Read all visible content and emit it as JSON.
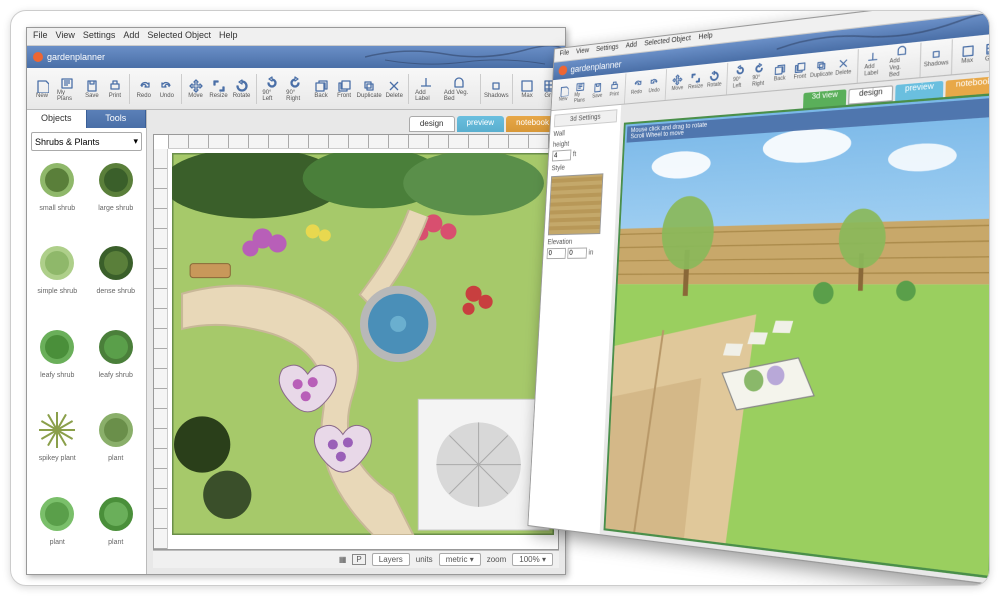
{
  "app": {
    "name": "gardenplanner"
  },
  "menu": [
    "File",
    "View",
    "Settings",
    "Add",
    "Selected Object",
    "Help"
  ],
  "toolbar": [
    {
      "icon": "new",
      "label": "New"
    },
    {
      "icon": "plans",
      "label": "My Plans"
    },
    {
      "icon": "save",
      "label": "Save"
    },
    {
      "icon": "print",
      "label": "Print"
    },
    {
      "sep": true
    },
    {
      "icon": "redo",
      "label": "Redo"
    },
    {
      "icon": "undo",
      "label": "Undo"
    },
    {
      "sep": true
    },
    {
      "icon": "move",
      "label": "Move"
    },
    {
      "icon": "resize",
      "label": "Resize"
    },
    {
      "icon": "rotate",
      "label": "Rotate"
    },
    {
      "sep": true
    },
    {
      "icon": "rot-l",
      "label": "90° Left"
    },
    {
      "icon": "rot-r",
      "label": "90° Right"
    },
    {
      "icon": "back",
      "label": "Back"
    },
    {
      "icon": "front",
      "label": "Front"
    },
    {
      "icon": "dup",
      "label": "Duplicate"
    },
    {
      "icon": "del",
      "label": "Delete"
    },
    {
      "sep": true
    },
    {
      "icon": "label",
      "label": "Add Label"
    },
    {
      "icon": "veg",
      "label": "Add Veg. Bed"
    },
    {
      "sep": true
    },
    {
      "icon": "shadow",
      "label": "Shadows"
    },
    {
      "sep": true
    },
    {
      "icon": "max",
      "label": "Max"
    },
    {
      "icon": "grid",
      "label": "Grid"
    }
  ],
  "sideTabs": {
    "objects": "Objects",
    "tools": "Tools"
  },
  "category": "Shrubs & Plants",
  "objects": [
    {
      "label": "small shrub",
      "fill": "#5a7f3a",
      "ring": "#8fb86a"
    },
    {
      "label": "large shrub",
      "fill": "#3a5f2a",
      "ring": "#5a7f3a"
    },
    {
      "label": "simple shrub",
      "fill": "#8fb86a",
      "ring": "#aecf8a"
    },
    {
      "label": "dense shrub",
      "fill": "#5a7f3a",
      "ring": "#3a5f2a"
    },
    {
      "label": "leafy shrub",
      "fill": "#4a8f3a",
      "ring": "#6aaf5a"
    },
    {
      "label": "leafy shrub",
      "fill": "#5a9f4a",
      "ring": "#4a7f3a"
    },
    {
      "label": "spikey plant",
      "fill": "#8a9f4a",
      "ring": "#aabf6a"
    },
    {
      "label": "plant",
      "fill": "#6a8f4a",
      "ring": "#8aaf6a"
    },
    {
      "label": "plant",
      "fill": "#5a9f4a",
      "ring": "#7abf6a"
    },
    {
      "label": "plant",
      "fill": "#6aaf5a",
      "ring": "#4a8f3a"
    }
  ],
  "canvasTabs": {
    "design": "design",
    "preview": "preview",
    "notebook": "notebook"
  },
  "status": {
    "layers": "Layers",
    "units": "units",
    "unitVal": "metric",
    "zoom": "zoom",
    "zoomVal": "100%"
  },
  "right": {
    "sideTab": "3d Settings",
    "wall": "Wall",
    "height": "height",
    "h1": "4",
    "h2": "ft",
    "style": "Style",
    "elevation": "Elevation",
    "e1": "0",
    "e2": "0",
    "e3": "in",
    "tabs": {
      "t1": "3d view",
      "t2": "design",
      "t3": "preview",
      "t4": "notebook"
    },
    "hint1": "Mouse click and drag to rotate",
    "hint2": "Scroll Wheel to move"
  }
}
